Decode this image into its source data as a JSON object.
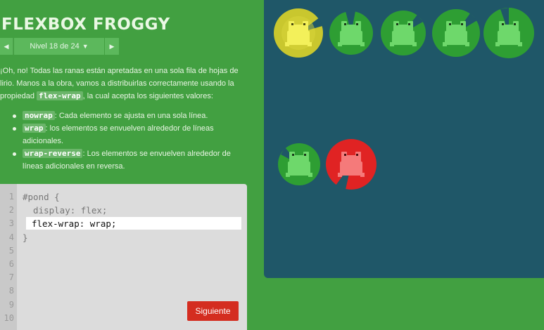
{
  "app": {
    "title": "FLEXBOX FROGGY"
  },
  "level_nav": {
    "prev_icon": "triangle-left-icon",
    "label": "Nivel 18 de 24",
    "caret": "▼",
    "next_icon": "triangle-right-icon"
  },
  "instructions": {
    "intro_part1": "¡Oh, no! Todas las ranas están apretadas en una sola fila de hojas de lirio. Manos a la obra, vamos a distribuirlas correctamente usando la propiedad ",
    "property": "flex-wrap",
    "intro_part2": ", la cual acepta los siguientes valores:",
    "values": [
      {
        "code": "nowrap",
        "text": ": Cada elemento se ajusta en una sola línea."
      },
      {
        "code": "wrap",
        "text": ": los elementos se envuelven alrededor de líneas adicionales."
      },
      {
        "code": "wrap-reverse",
        "text": ": Los elementos se envuelven alrededor de líneas adicionales en reversa."
      }
    ]
  },
  "editor": {
    "line_numbers": [
      "1",
      "2",
      "3",
      "4",
      "5",
      "6",
      "7",
      "8",
      "9",
      "10"
    ],
    "line1": "#pond {",
    "line2": "  display: flex;",
    "input_value": "flex-wrap: wrap;",
    "line4": "}",
    "submit_label": "Siguiente"
  },
  "board": {
    "colors": {
      "background": "#1f5768",
      "yellow_lily": "#c9c72e",
      "green_lily": "#2e9e33",
      "red_lily": "#e02323",
      "yellow_frog": "#f3f05a",
      "green_frog": "#6ed86b",
      "red_frog": "#f57a7a"
    },
    "lilypads_row1": [
      "yellow",
      "green",
      "green",
      "green",
      "green"
    ],
    "frogs_row2": [
      "green",
      "red"
    ]
  }
}
